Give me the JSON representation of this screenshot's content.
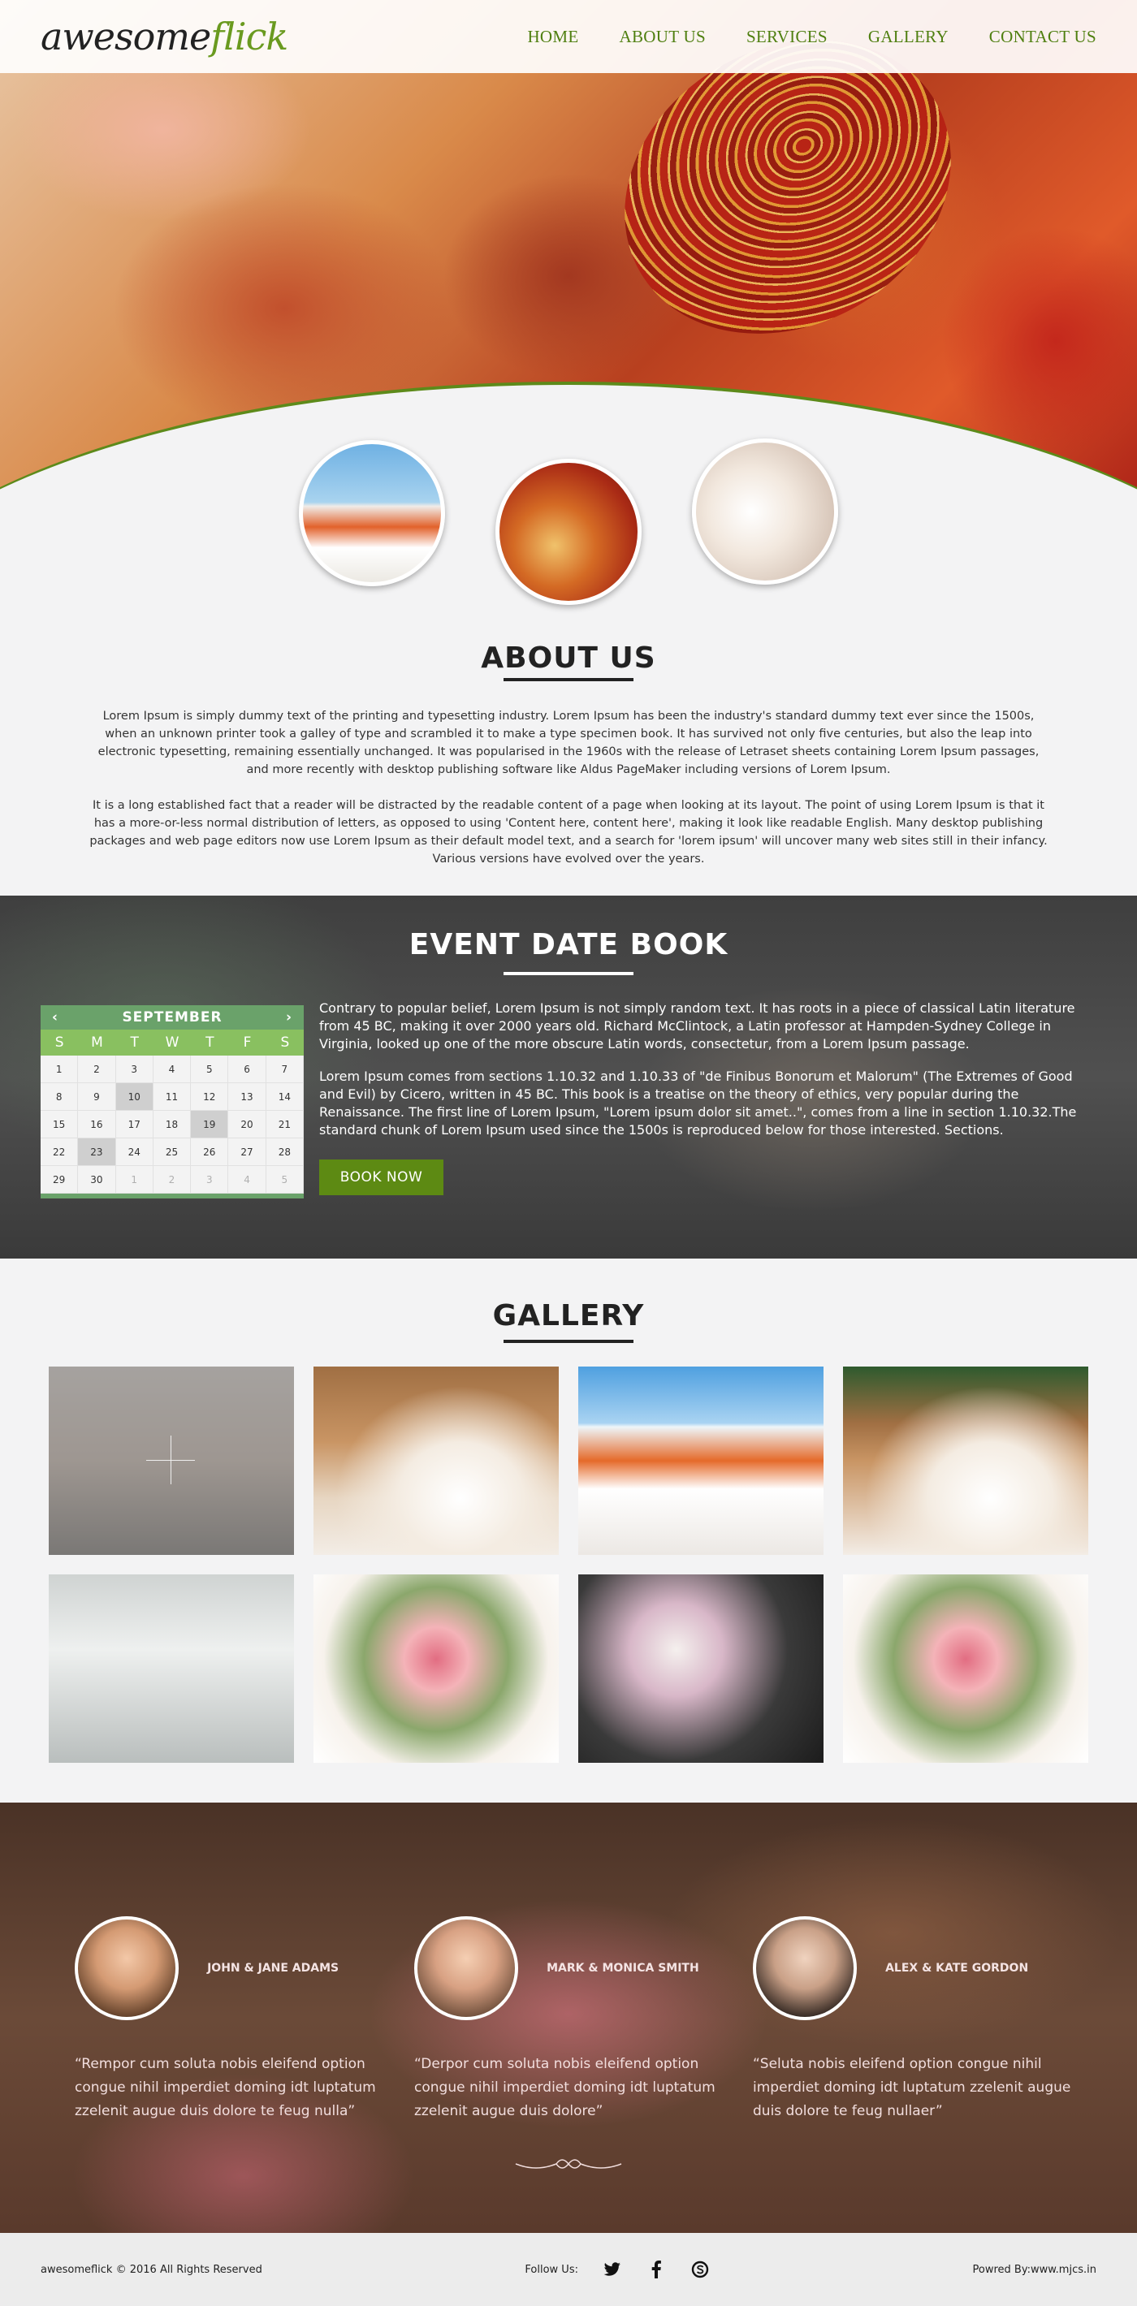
{
  "header": {
    "logo_main": "awesome",
    "logo_accent": "flick",
    "nav": [
      "HOME",
      "ABOUT US",
      "SERVICES",
      "GALLERY",
      "CONTACT US"
    ]
  },
  "about": {
    "title": "ABOUT US",
    "p1": "Lorem Ipsum is simply dummy text of the printing and typesetting industry. Lorem Ipsum has been the industry's standard dummy text ever since the 1500s, when an unknown printer took a galley of type and scrambled it to make a type specimen book. It has survived not only five centuries, but also the leap into electronic typesetting, remaining essentially unchanged. It was popularised in the 1960s with the release of Letraset sheets containing Lorem Ipsum passages, and more recently with desktop publishing software like Aldus PageMaker including versions of Lorem Ipsum.",
    "p2": "It is a long established fact that a reader will be distracted by the readable content of a page when looking at its layout. The point of using Lorem Ipsum is that it has a more-or-less normal distribution of letters, as opposed to using 'Content here, content here', making it look like readable English. Many desktop publishing packages and web page editors now use Lorem Ipsum as their default model text, and a search for 'lorem ipsum' will uncover many web sites still in their infancy. Various versions have evolved over the years."
  },
  "event": {
    "title": "EVENT DATE BOOK",
    "p1": "Contrary to popular belief, Lorem Ipsum is not simply random text. It has roots in a piece of classical Latin literature from 45 BC, making it over 2000 years old. Richard McClintock, a Latin professor at Hampden-Sydney College in Virginia, looked up one of the more obscure Latin words, consectetur, from a Lorem Ipsum passage.",
    "p2": "Lorem Ipsum comes from sections 1.10.32 and 1.10.33 of \"de Finibus Bonorum et Malorum\" (The Extremes of Good and Evil) by Cicero, written in 45 BC. This book is a treatise on the theory of ethics, very popular during the Renaissance. The first line of Lorem Ipsum, \"Lorem ipsum dolor sit amet..\", comes from a line in section 1.10.32.The standard chunk of Lorem Ipsum used since the 1500s is reproduced below for those interested. Sections.",
    "button": "BOOK NOW",
    "calendar": {
      "month": "SEPTEMBER",
      "prev": "‹",
      "next": "›",
      "weekdays": [
        "S",
        "M",
        "T",
        "W",
        "T",
        "F",
        "S"
      ],
      "cells": [
        "1",
        "2",
        "3",
        "4",
        "5",
        "6",
        "7",
        "8",
        "9",
        "10",
        "11",
        "12",
        "13",
        "14",
        "15",
        "16",
        "17",
        "18",
        "19",
        "20",
        "21",
        "22",
        "23",
        "24",
        "25",
        "26",
        "27",
        "28",
        "29",
        "30",
        "1",
        "2",
        "3",
        "4",
        "5"
      ],
      "highlighted": [
        9,
        18,
        22
      ],
      "muted_from": 30
    }
  },
  "gallery": {
    "title": "GALLERY"
  },
  "testimonials": [
    {
      "name": "JOHN & JANE ADAMS",
      "quote": "“Rempor cum soluta nobis eleifend option congue nihil imperdiet doming idt luptatum zzelenit augue duis dolore te feug nulla”"
    },
    {
      "name": "MARK & MONICA SMITH",
      "quote": "“Derpor cum soluta nobis eleifend option congue nihil imperdiet doming idt luptatum zzelenit augue duis dolore”"
    },
    {
      "name": "ALEX & KATE GORDON",
      "quote": "“Seluta nobis eleifend option congue nihil imperdiet doming idt luptatum zzelenit augue duis dolore te feug nullaer”"
    }
  ],
  "footer": {
    "copyright": "awesomeflick © 2016 All Rights Reserved",
    "follow_label": "Follow Us:",
    "social_icons": [
      "twitter-icon",
      "facebook-icon",
      "skype-icon"
    ],
    "credit": "Powred By:www.mjcs.in"
  }
}
